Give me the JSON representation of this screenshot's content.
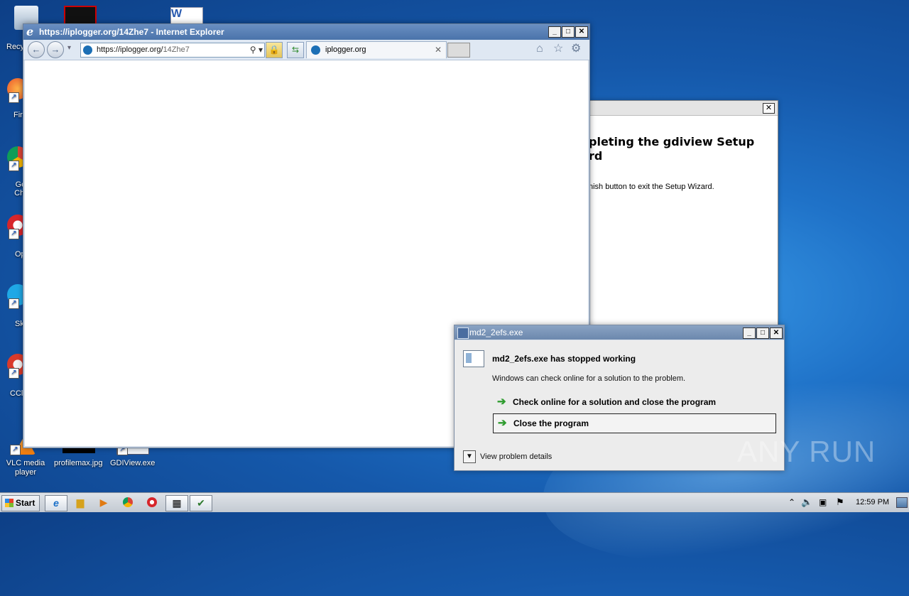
{
  "ie": {
    "title": "https://iplogger.org/14Zhe7 - Internet Explorer",
    "address_host": "https://iplogger.org/",
    "address_path": "14Zhe7",
    "tab_label": "iplogger.org"
  },
  "wizard": {
    "heading_line1": "pleting the gdiview Setup",
    "heading_line2": "rd",
    "text": "nish button to exit the Setup Wizard."
  },
  "dialog": {
    "title": "md2_2efs.exe",
    "heading": "md2_2efs.exe has stopped working",
    "subtext": "Windows can check online for a solution to the problem.",
    "option_check": "Check online for a solution and close the program",
    "option_close": "Close the program",
    "details": "View problem details"
  },
  "desktop": {
    "icons": [
      {
        "label": "Recy"
      },
      {
        "label": "Fir"
      },
      {
        "label": "Go Chr"
      },
      {
        "label": "Op"
      },
      {
        "label": "Sk"
      },
      {
        "label": "CCl"
      },
      {
        "label": "VLC media player"
      },
      {
        "label": "profilemax.jpg"
      },
      {
        "label": "GDIView.exe"
      }
    ],
    "watermark": "ANY RUN"
  },
  "taskbar": {
    "start_label": "Start",
    "clock": "12:59 PM"
  }
}
